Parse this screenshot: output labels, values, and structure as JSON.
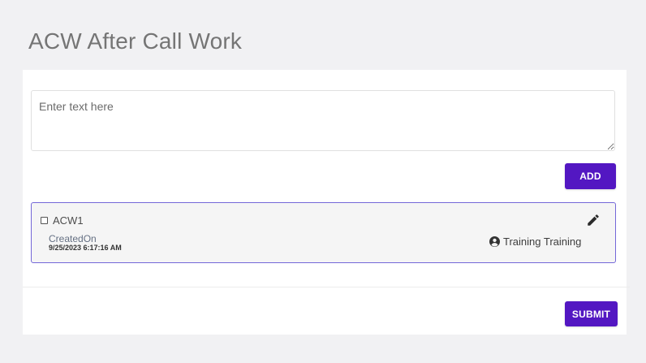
{
  "page": {
    "title": "ACW After Call Work"
  },
  "form": {
    "placeholder": "Enter text here",
    "add_label": "ADD",
    "submit_label": "SUBMIT"
  },
  "items": [
    {
      "title": "ACW1",
      "created_label": "CreatedOn",
      "created_value": "9/25/2023 6:17:16 AM",
      "user": "Training Training",
      "checked": false
    }
  ],
  "icons": {
    "edit": "pencil-icon",
    "user": "account-circle-icon"
  },
  "colors": {
    "accent": "#5317c2",
    "item_border": "#7468d8",
    "background": "#f1f1f3"
  }
}
